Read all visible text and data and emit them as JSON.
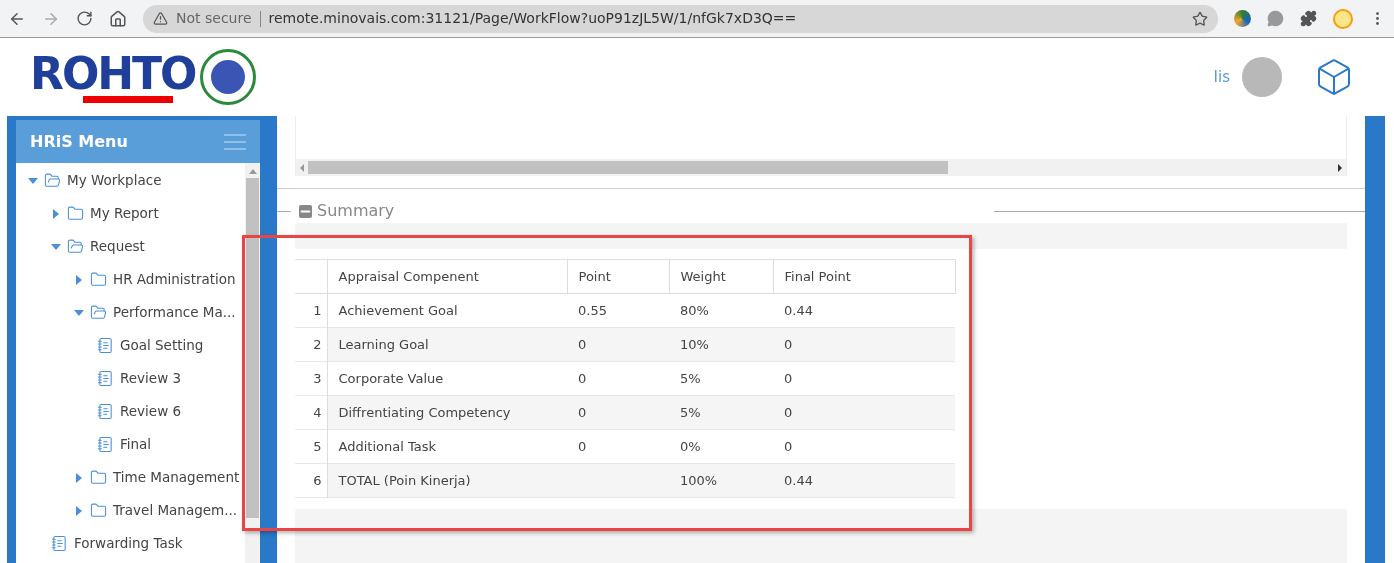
{
  "browser": {
    "security": "Not secure",
    "url": "remote.minovais.com:31121/Page/WorkFlow?uoP91zJL5W/1/nfGk7xD3Q=="
  },
  "header": {
    "logo": "ROHTO",
    "user": "Iis"
  },
  "sidebar": {
    "title": "HRiS Menu",
    "tree": [
      {
        "label": "My Workplace",
        "kind": "folder",
        "expanded": true,
        "children": [
          {
            "label": "My Report",
            "kind": "folder",
            "expanded": false
          },
          {
            "label": "Request",
            "kind": "folder",
            "expanded": true,
            "children": [
              {
                "label": "HR Administration",
                "kind": "folder",
                "expanded": false
              },
              {
                "label": "Performance Ma...",
                "kind": "folder",
                "expanded": true,
                "children": [
                  {
                    "label": "Goal Setting",
                    "kind": "page"
                  },
                  {
                    "label": "Review 3",
                    "kind": "page"
                  },
                  {
                    "label": "Review 6",
                    "kind": "page"
                  },
                  {
                    "label": "Final",
                    "kind": "page"
                  }
                ]
              },
              {
                "label": "Time Management",
                "kind": "folder",
                "expanded": false
              },
              {
                "label": "Travel Managem...",
                "kind": "folder",
                "expanded": false
              }
            ]
          },
          {
            "label": "Forwarding Task",
            "kind": "page"
          }
        ]
      }
    ]
  },
  "summary": {
    "title": "Summary",
    "table": {
      "columns": [
        "Appraisal Compenent",
        "Point",
        "Weight",
        "Final Point"
      ],
      "rows": [
        {
          "no": "1",
          "cells": [
            "Achievement Goal",
            "0.55",
            "80%",
            "0.44"
          ]
        },
        {
          "no": "2",
          "cells": [
            "Learning Goal",
            "0",
            "10%",
            "0"
          ]
        },
        {
          "no": "3",
          "cells": [
            "Corporate Value",
            "0",
            "5%",
            "0"
          ]
        },
        {
          "no": "4",
          "cells": [
            "Diffrentiating Competency",
            "0",
            "5%",
            "0"
          ]
        },
        {
          "no": "5",
          "cells": [
            "Additional Task",
            "0",
            "0%",
            "0"
          ]
        },
        {
          "no": "6",
          "cells": [
            "TOTAL (Poin Kinerja)",
            "",
            "100%",
            "0.44"
          ]
        }
      ]
    }
  }
}
